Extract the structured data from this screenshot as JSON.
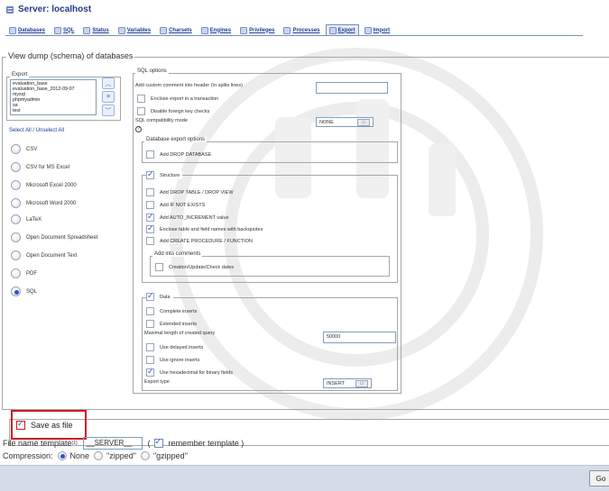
{
  "header": {
    "title": "Server: localhost"
  },
  "tabs": [
    {
      "label": "Databases",
      "icon": "databases-icon"
    },
    {
      "label": "SQL",
      "icon": "sql-icon"
    },
    {
      "label": "Status",
      "icon": "status-icon"
    },
    {
      "label": "Variables",
      "icon": "variables-icon"
    },
    {
      "label": "Charsets",
      "icon": "charsets-icon"
    },
    {
      "label": "Engines",
      "icon": "engines-icon"
    },
    {
      "label": "Privileges",
      "icon": "privileges-icon"
    },
    {
      "label": "Processes",
      "icon": "processes-icon"
    },
    {
      "label": "Export",
      "icon": "export-icon",
      "active": true
    },
    {
      "label": "Import",
      "icon": "import-icon"
    }
  ],
  "main": {
    "legend": "View dump (schema) of databases",
    "export": {
      "legend": "Export",
      "databases": [
        "evaluation_base",
        "evaluation_base_2012-09-07",
        "mysql",
        "phpmyadmin",
        "sa",
        "test"
      ],
      "select_all": "Select All / Unselect All",
      "formats": [
        {
          "label": "CSV",
          "checked": false
        },
        {
          "label": "CSV for MS Excel",
          "checked": false
        },
        {
          "label": "Microsoft Excel 2000",
          "checked": false
        },
        {
          "label": "Microsoft Word 2000",
          "checked": false
        },
        {
          "label": "LaTeX",
          "checked": false
        },
        {
          "label": "Open Document Spreadsheet",
          "checked": false
        },
        {
          "label": "Open Document Text",
          "checked": false
        },
        {
          "label": "PDF",
          "checked": false
        },
        {
          "label": "SQL",
          "checked": true
        }
      ]
    },
    "sql_options": {
      "legend": "SQL options",
      "custom_comment_label": "Add custom comment into header (\\n splits lines)",
      "custom_comment_value": "",
      "enclose_transaction": {
        "label": "Enclose export in a transaction",
        "checked": false
      },
      "disable_fk": {
        "label": "Disable foreign key checks",
        "checked": false
      },
      "compat_label": "SQL compatibility mode",
      "compat_value": "NONE",
      "help_icon": "help-icon",
      "db_export": {
        "legend": "Database export options",
        "add_drop_database": {
          "label": "Add DROP DATABASE",
          "checked": false
        }
      },
      "structure": {
        "label": "Structure",
        "checked": true,
        "options": [
          {
            "label": "Add DROP TABLE / DROP VIEW",
            "checked": false
          },
          {
            "label": "Add IF NOT EXISTS",
            "checked": false
          },
          {
            "label": "Add AUTO_INCREMENT value",
            "checked": true
          },
          {
            "label": "Enclose table and field names with backquotes",
            "checked": true
          },
          {
            "label": "Add CREATE PROCEDURE / FUNCTION",
            "checked": false
          }
        ],
        "comments": {
          "legend": "Add into comments",
          "option": {
            "label": "Creation/Update/Check dates",
            "checked": false
          }
        }
      },
      "data": {
        "label": "Data",
        "checked": true,
        "complete_inserts": {
          "label": "Complete inserts",
          "checked": false
        },
        "extended_inserts": {
          "label": "Extended inserts",
          "checked": false
        },
        "max_length_label": "Maximal length of created query",
        "max_length_value": "50000",
        "delayed": {
          "label": "Use delayed inserts",
          "checked": false
        },
        "ignore": {
          "label": "Use ignore inserts",
          "checked": false
        },
        "hex": {
          "label": "Use hexadecimal for binary fields",
          "checked": true
        },
        "export_type_label": "Export type",
        "export_type_value": "INSERT"
      }
    }
  },
  "save": {
    "label": "Save as file",
    "checked": true,
    "filename_label": "File name template",
    "filename_sup": "(1)",
    "filename_value": "__SERVER__",
    "remember_open": "(",
    "remember_label": "remember template )",
    "remember_checked": true,
    "compression_label": "Compression:",
    "compression": [
      {
        "label": "None",
        "checked": true
      },
      {
        "label": "\"zipped\"",
        "checked": false
      },
      {
        "label": "\"gzipped\"",
        "checked": false
      }
    ]
  },
  "footer": {
    "go_label": "Go"
  },
  "colors": {
    "accent": "#2a55c8",
    "link": "#1b3a99",
    "highlight": "#d1191d",
    "footer": "#d5dce8"
  }
}
